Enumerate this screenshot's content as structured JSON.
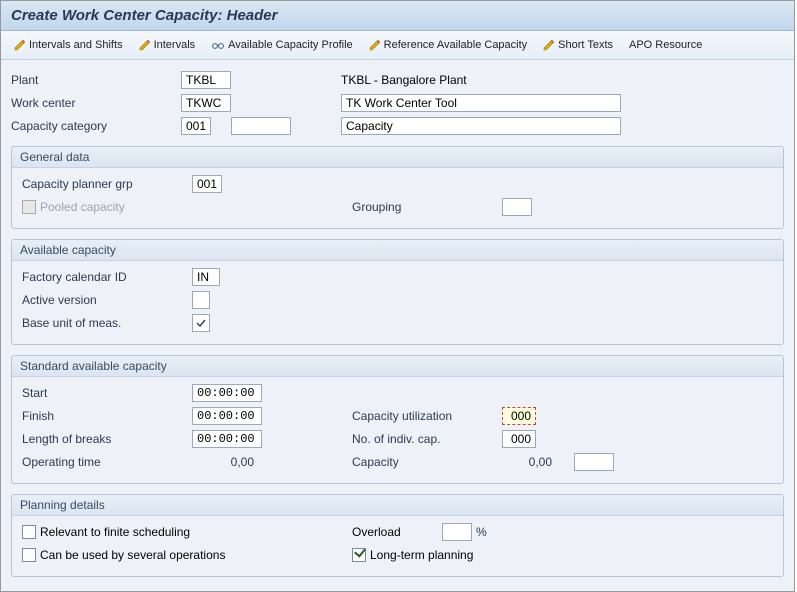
{
  "title": "Create Work Center Capacity: Header",
  "toolbar": {
    "intervals_shifts": "Intervals and Shifts",
    "intervals": "Intervals",
    "avail_profile": "Available Capacity Profile",
    "ref_avail": "Reference Available Capacity",
    "short_texts": "Short Texts",
    "apo_resource": "APO Resource"
  },
  "header": {
    "plant_label": "Plant",
    "plant": "TKBL",
    "plant_text": "TKBL - Bangalore Plant",
    "work_center_label": "Work center",
    "work_center": "TKWC",
    "work_center_text": "TK Work Center Tool",
    "cap_cat_label": "Capacity category",
    "cap_cat": "001",
    "cap_cat_extra": "",
    "cap_cat_text": "Capacity"
  },
  "general": {
    "title": "General data",
    "planner_grp_label": "Capacity planner grp",
    "planner_grp": "001",
    "pooled_label": "Pooled capacity",
    "grouping_label": "Grouping",
    "grouping": ""
  },
  "avail": {
    "title": "Available capacity",
    "factory_cal_label": "Factory calendar ID",
    "factory_cal": "IN",
    "active_ver_label": "Active version",
    "active_ver": "",
    "base_uom_label": "Base unit of meas.",
    "base_uom_checked": true
  },
  "std": {
    "title": "Standard available capacity",
    "start_label": "Start",
    "start": "00:00:00",
    "finish_label": "Finish",
    "finish": "00:00:00",
    "breaks_label": "Length of breaks",
    "breaks": "00:00:00",
    "optime_label": "Operating time",
    "optime": "0,00",
    "util_label": "Capacity utilization",
    "util": "000",
    "indiv_label": "No. of indiv. cap.",
    "indiv": "000",
    "cap_label": "Capacity",
    "cap": "0,00"
  },
  "plan": {
    "title": "Planning details",
    "finite_label": "Relevant to finite scheduling",
    "several_label": "Can be used by several operations",
    "overload_label": "Overload",
    "overload": "",
    "pct": "%",
    "longterm_label": "Long-term planning",
    "longterm_checked": true
  }
}
